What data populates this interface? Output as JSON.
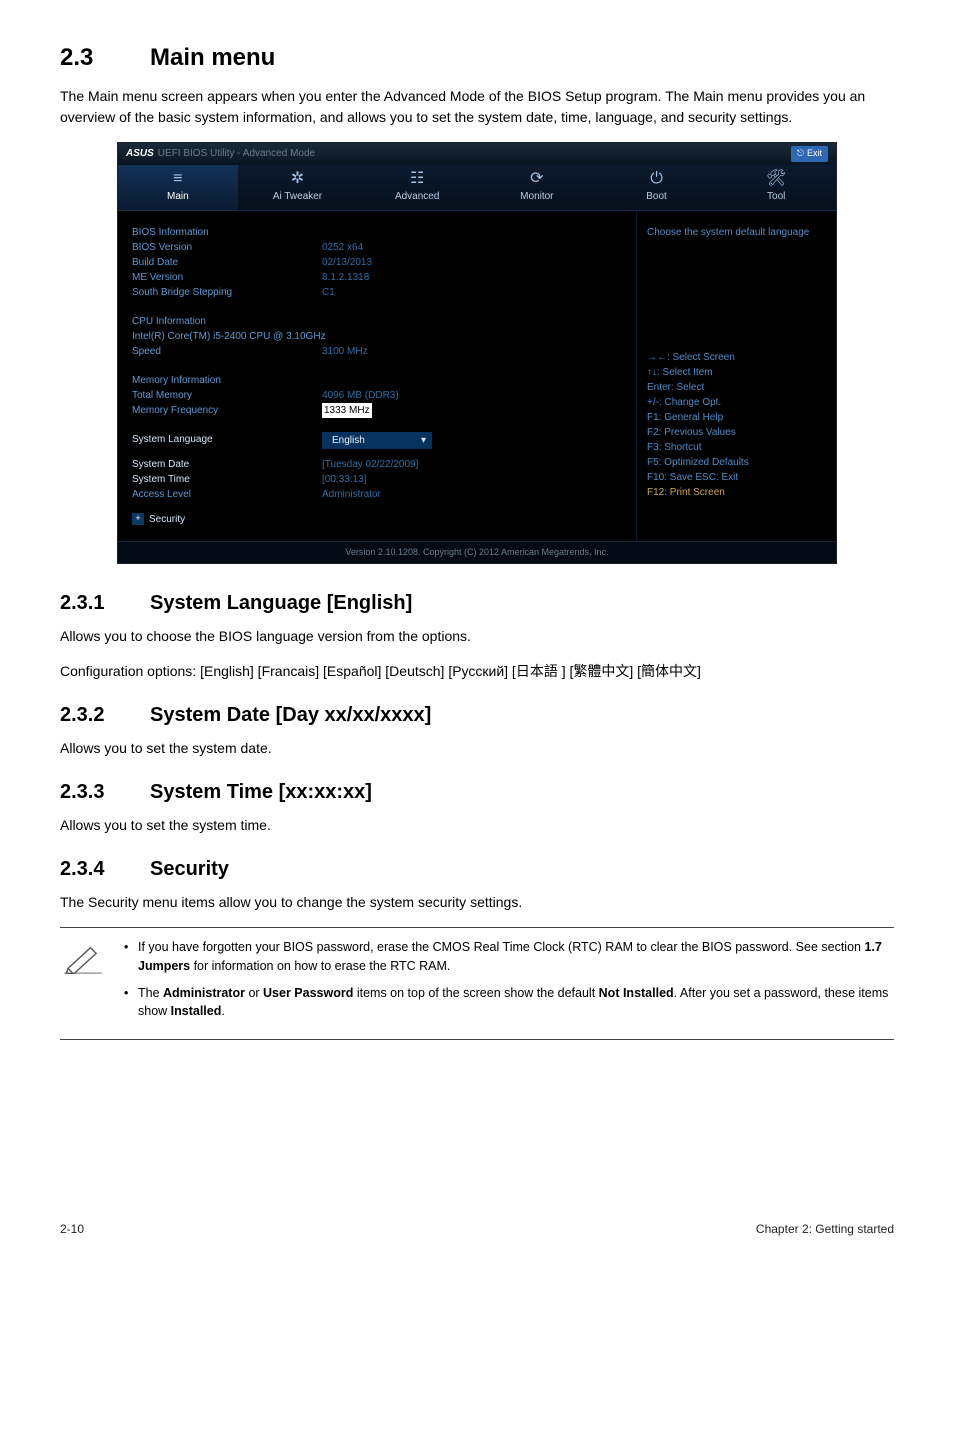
{
  "section": {
    "num": "2.3",
    "title": "Main menu"
  },
  "intro": "The Main menu screen appears when you enter the Advanced Mode of the BIOS Setup program. The Main menu provides you an overview of the basic system information, and allows you to set the system date, time, language, and security settings.",
  "bios": {
    "titlebar": {
      "brand": "ASUS",
      "title": "UEFI BIOS Utility - Advanced Mode",
      "exit": "Exit"
    },
    "tabs": [
      {
        "icon": "≡",
        "label": "Main"
      },
      {
        "icon": "✲",
        "label": "Ai Tweaker"
      },
      {
        "icon": "☷",
        "label": "Advanced"
      },
      {
        "icon": "⟳",
        "label": "Monitor"
      },
      {
        "icon": "⏻",
        "label": "Boot"
      },
      {
        "icon": "🛠",
        "label": "Tool"
      }
    ],
    "left": {
      "biosInfo": {
        "header": "BIOS Information",
        "rows": [
          {
            "label": "BIOS Version",
            "value": "0252 x64"
          },
          {
            "label": "Build Date",
            "value": "02/13/2013"
          },
          {
            "label": "ME Version",
            "value": "8.1.2.1318"
          },
          {
            "label": "South Bridge Stepping",
            "value": "C1"
          }
        ]
      },
      "cpuInfo": {
        "header": "CPU Information",
        "model": "Intel(R) Core(TM) i5-2400 CPU @ 3.10GHz",
        "speedLabel": "Speed",
        "speedValue": "3100 MHz"
      },
      "memInfo": {
        "header": "Memory Information",
        "rows": [
          {
            "label": "Total Memory",
            "value": "4096 MB (DDR3)"
          },
          {
            "label": "Memory Frequency",
            "value": "1333 MHz"
          }
        ]
      },
      "sysLang": {
        "label": "System Language",
        "value": "English"
      },
      "sysDate": {
        "label": "System Date",
        "value": "[Tuesday 02/22/2009]"
      },
      "sysTime": {
        "label": "System Time",
        "value": "[00:33:13]"
      },
      "access": {
        "label": "Access Level",
        "value": "Administrator"
      },
      "security": "Security"
    },
    "right": {
      "desc": "Choose the system default language",
      "keys": [
        "→←: Select Screen",
        "↑↓: Select Item",
        "Enter: Select",
        "+/-: Change Opt.",
        "F1: General Help",
        "F2: Previous Values",
        "F3: Shortcut",
        "F5: Optimized Defaults",
        "F10: Save ESC: Exit",
        "F12: Print Screen"
      ]
    },
    "footer": "Version 2.10.1208. Copyright (C) 2012 American Megatrends, Inc."
  },
  "subs": {
    "s231": {
      "num": "2.3.1",
      "title": "System Language [English]",
      "p1": "Allows you to choose the BIOS language version from the options.",
      "p2": "Configuration options: [English] [Francais] [Español] [Deutsch] [Русский] [日本語 ] [繁體中文] [簡体中文]"
    },
    "s232": {
      "num": "2.3.2",
      "title": "System Date [Day xx/xx/xxxx]",
      "p1": "Allows you to set the system date."
    },
    "s233": {
      "num": "2.3.3",
      "title": "System Time [xx:xx:xx]",
      "p1": "Allows you to set the system time."
    },
    "s234": {
      "num": "2.3.4",
      "title": "Security",
      "p1": "The Security menu items allow you to change the system security settings."
    }
  },
  "notes": {
    "n1a": "If you have forgotten your BIOS password, erase the CMOS Real Time Clock (RTC) RAM to clear the BIOS password. See section ",
    "n1b": "1.7 Jumpers",
    "n1c": " for information on how to erase the RTC RAM.",
    "n2a": "The ",
    "n2b": "Administrator",
    "n2c": " or ",
    "n2d": "User Password",
    "n2e": " items on top of the screen show the default ",
    "n2f": "Not Installed",
    "n2g": ". After you set a password, these items show ",
    "n2h": "Installed",
    "n2i": "."
  },
  "footer": {
    "page": "2-10",
    "chapter": "Chapter 2: Getting started"
  }
}
